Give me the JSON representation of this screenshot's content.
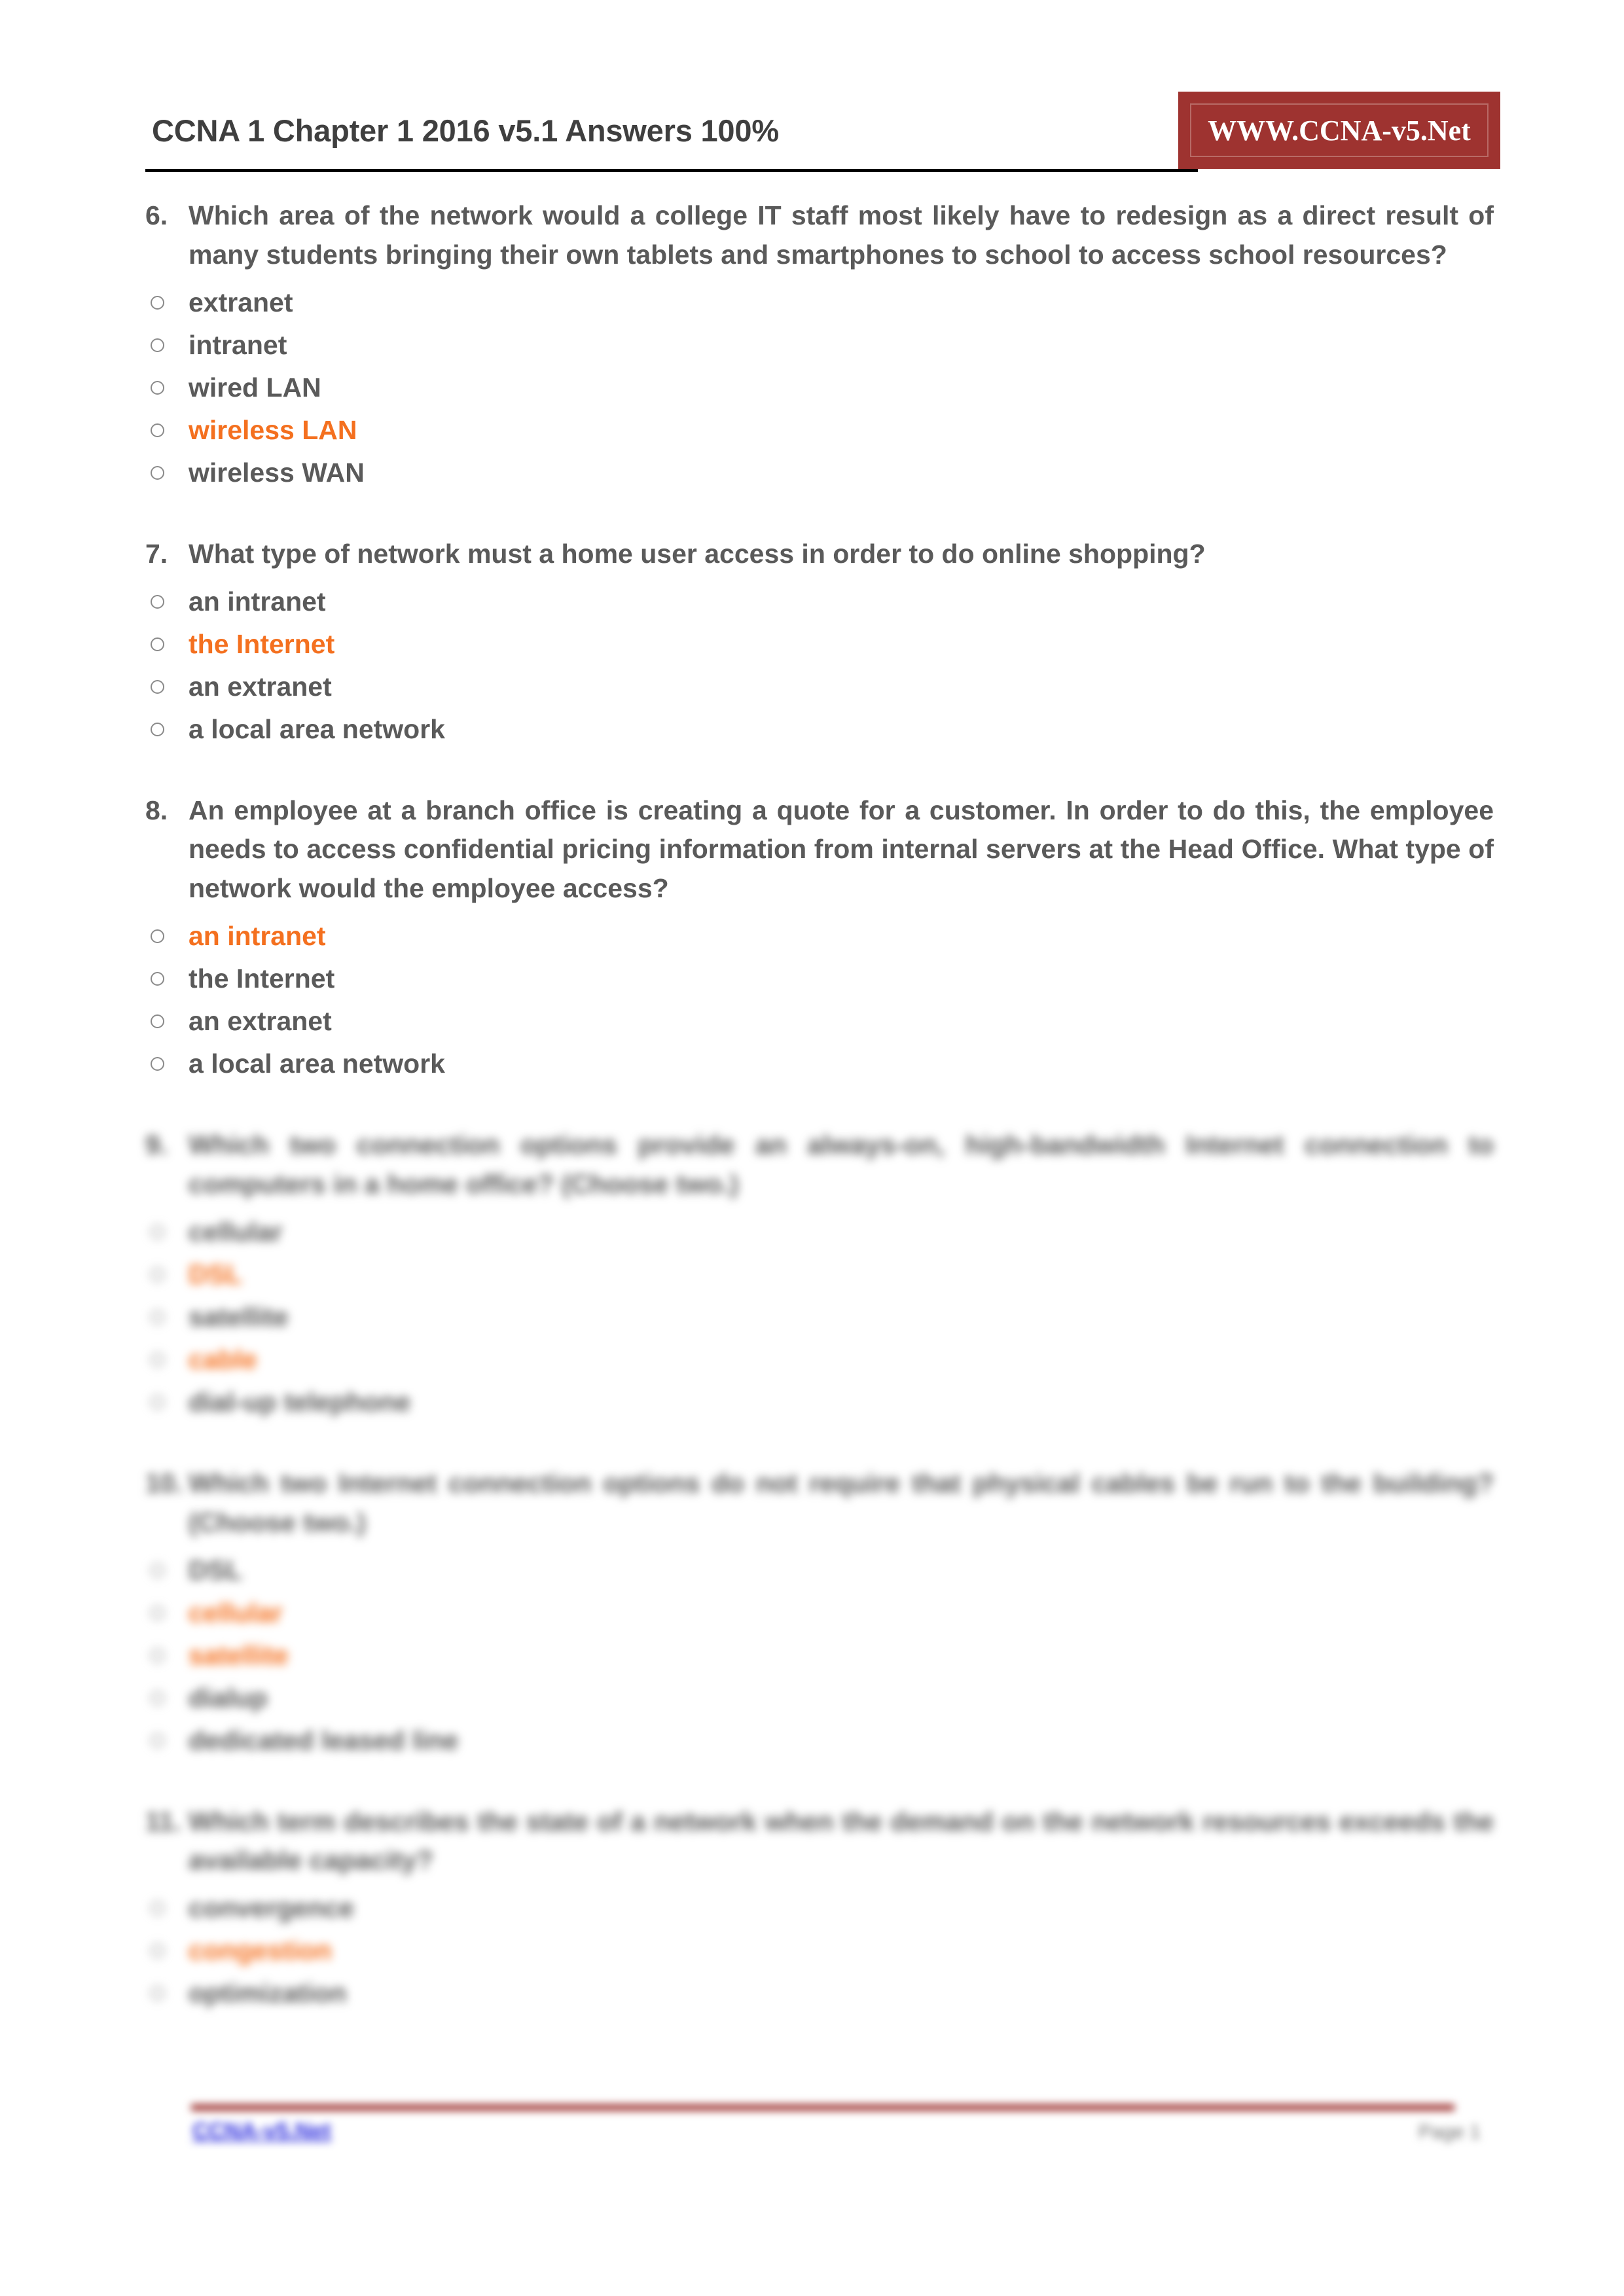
{
  "header": {
    "title": "CCNA 1 Chapter 1 2016 v5.1 Answers 100%",
    "banner_text": "WWW.CCNA-v5.Net"
  },
  "colors": {
    "banner_background": "#9e3330",
    "correct_answer": "#f4701f",
    "body_text": "#5a5a5a",
    "footer_rule": "#9e3330",
    "footer_link": "#2b2bdd"
  },
  "questions": [
    {
      "number": "6.",
      "text": "Which area of the network would a college IT staff most likely have to redesign as a direct result of many students bringing their own tablets and smartphones to school to access school resources?",
      "options": [
        {
          "label": "extranet",
          "correct": false
        },
        {
          "label": "intranet",
          "correct": false
        },
        {
          "label": "wired LAN",
          "correct": false
        },
        {
          "label": "wireless LAN",
          "correct": true
        },
        {
          "label": "wireless WAN",
          "correct": false
        }
      ]
    },
    {
      "number": "7.",
      "text": "What type of network must a home user access in order to do online shopping?",
      "options": [
        {
          "label": "an intranet",
          "correct": false
        },
        {
          "label": "the Internet",
          "correct": true
        },
        {
          "label": "an extranet",
          "correct": false
        },
        {
          "label": "a local area network",
          "correct": false
        }
      ]
    },
    {
      "number": "8.",
      "text": "An employee at a branch office is creating a quote for a customer. In order to do this, the employee needs to access confidential pricing information from internal servers at the Head Office. What type of network would the employee access?",
      "options": [
        {
          "label": "an intranet",
          "correct": true
        },
        {
          "label": "the Internet",
          "correct": false
        },
        {
          "label": "an extranet",
          "correct": false
        },
        {
          "label": "a local area network",
          "correct": false
        }
      ]
    },
    {
      "number": "9.",
      "text": "Which two connection options provide an always-on, high-bandwidth Internet connection to computers in a home office? (Choose two.)",
      "blurred": true,
      "options": [
        {
          "label": "cellular",
          "correct": false
        },
        {
          "label": "DSL",
          "correct": true
        },
        {
          "label": "satellite",
          "correct": false
        },
        {
          "label": "cable",
          "correct": true
        },
        {
          "label": "dial-up telephone",
          "correct": false
        }
      ]
    },
    {
      "number": "10.",
      "text": "Which two Internet connection options do not require that physical cables be run to the building? (Choose two.)",
      "blurred": true,
      "options": [
        {
          "label": "DSL",
          "correct": false
        },
        {
          "label": "cellular",
          "correct": true
        },
        {
          "label": "satellite",
          "correct": true
        },
        {
          "label": "dialup",
          "correct": false
        },
        {
          "label": "dedicated leased line",
          "correct": false
        }
      ]
    },
    {
      "number": "11.",
      "text": "Which term describes the state of a network when the demand on the network resources exceeds the available capacity?",
      "blurred": true,
      "options": [
        {
          "label": "convergence",
          "correct": false
        },
        {
          "label": "congestion",
          "correct": true
        },
        {
          "label": "optimization",
          "correct": false
        }
      ]
    }
  ],
  "footer": {
    "link": "CCNA-v5.Net",
    "page": "Page 1"
  }
}
